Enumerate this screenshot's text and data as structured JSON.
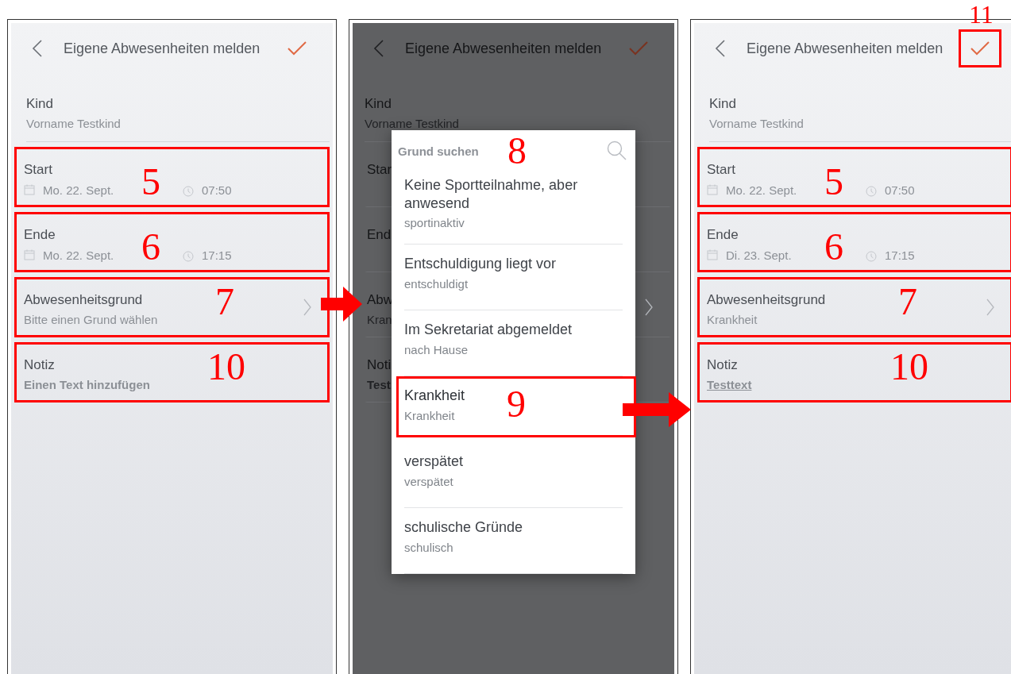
{
  "panels": [
    {
      "title": "Eigene Abwesenheiten melden",
      "dimmed": false,
      "child": {
        "label": "Kind",
        "value": "Vorname Testkind"
      },
      "fields": [
        {
          "kind": "datetime",
          "label": "Start",
          "date": "Mo. 22. Sept.",
          "time": "07:50",
          "annotation": "5"
        },
        {
          "kind": "datetime",
          "label": "Ende",
          "date": "Mo. 22. Sept.",
          "time": "17:15",
          "annotation": "6"
        },
        {
          "kind": "select",
          "label": "Abwesenheitsgrund",
          "value": "Bitte einen Grund wählen",
          "annotation": "7"
        },
        {
          "kind": "note",
          "label": "Notiz",
          "value": "Einen Text hinzufügen",
          "underlined": false,
          "annotation": "10"
        }
      ]
    },
    {
      "title": "Eigene Abwesenheiten melden",
      "dimmed": true,
      "child": {
        "label": "Kind",
        "value": "Vorname Testkind"
      },
      "fields": [
        {
          "kind": "datetime",
          "label": "Star"
        },
        {
          "kind": "datetime",
          "label": "End"
        },
        {
          "kind": "select",
          "label": "Abw",
          "value": "Kran"
        },
        {
          "kind": "note",
          "label": "Noti",
          "value": "Test",
          "underlined": false
        }
      ],
      "dialog": {
        "search_placeholder": "Grund suchen",
        "annotation": "8",
        "options": [
          {
            "title": "Keine Sportteilnahme, aber anwesend",
            "subtitle": "sportinaktiv",
            "selected": false
          },
          {
            "title": "Entschuldigung liegt vor",
            "subtitle": "entschuldigt",
            "selected": false
          },
          {
            "title": "Im Sekretariat abgemeldet",
            "subtitle": "nach Hause",
            "selected": false
          },
          {
            "title": "Krankheit",
            "subtitle": "Krankheit",
            "selected": true,
            "annotation": "9"
          },
          {
            "title": "verspätet",
            "subtitle": "verspätet",
            "selected": false
          },
          {
            "title": "schulische Gründe",
            "subtitle": "schulisch",
            "selected": false
          }
        ]
      }
    },
    {
      "title": "Eigene Abwesenheiten melden",
      "dimmed": false,
      "confirm_annotation": "11",
      "child": {
        "label": "Kind",
        "value": "Vorname Testkind"
      },
      "fields": [
        {
          "kind": "datetime",
          "label": "Start",
          "date": "Mo. 22. Sept.",
          "time": "07:50",
          "annotation": "5"
        },
        {
          "kind": "datetime",
          "label": "Ende",
          "date": "Di. 23. Sept.",
          "time": "17:15",
          "annotation": "6"
        },
        {
          "kind": "select",
          "label": "Abwesenheitsgrund",
          "value": "Krankheit",
          "annotation": "7"
        },
        {
          "kind": "note",
          "label": "Notiz",
          "value": "Testtext",
          "underlined": true,
          "annotation": "10"
        }
      ]
    }
  ]
}
